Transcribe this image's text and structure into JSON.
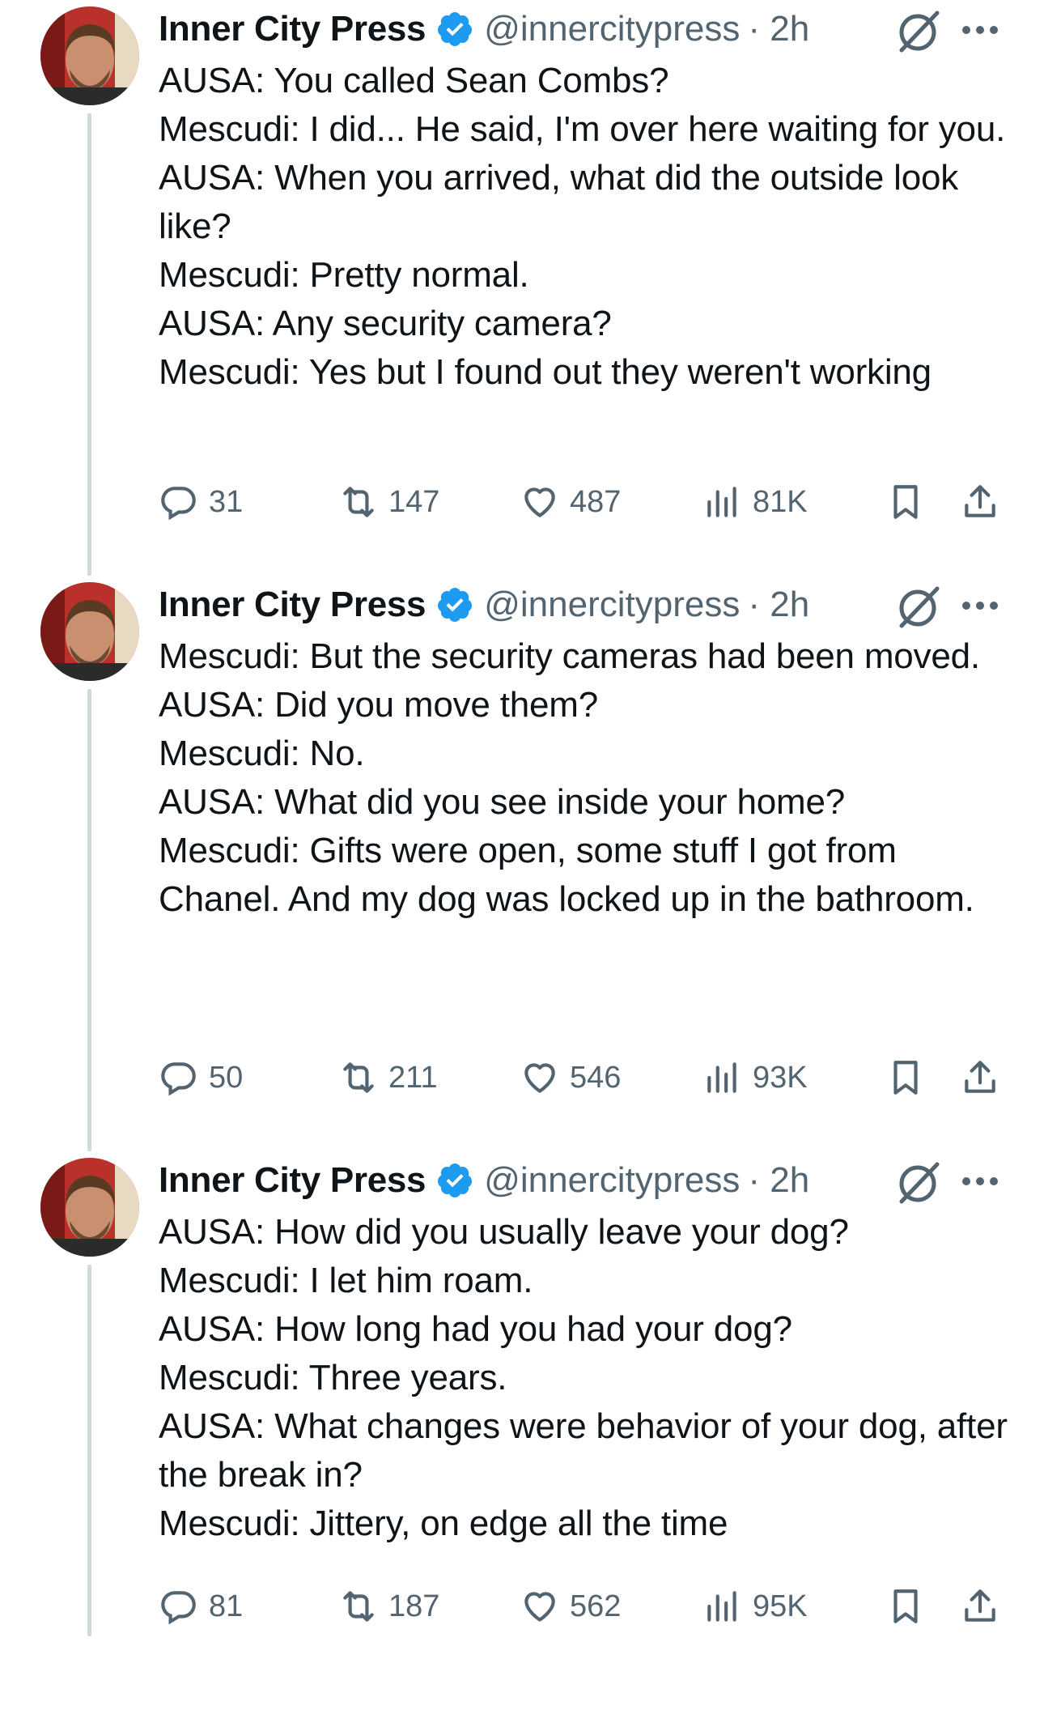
{
  "tweets": [
    {
      "author": "Inner City Press",
      "handle": "@innercitypress",
      "time": "· 2h",
      "lines": [
        "AUSA: You called Sean Combs?",
        "Mescudi: I did... He said, I'm over here waiting for you.",
        "AUSA: When you arrived, what did the outside look like?",
        "Mescudi: Pretty normal.",
        "AUSA: Any security camera?",
        "Mescudi: Yes but I found out they weren't working"
      ],
      "replies": "31",
      "reposts": "147",
      "likes": "487",
      "views": "81K"
    },
    {
      "author": "Inner City Press",
      "handle": "@innercitypress",
      "time": "· 2h",
      "lines": [
        "Mescudi: But the security cameras had been moved.",
        "AUSA: Did you move them?",
        "Mescudi: No.",
        "AUSA: What did you see inside your home?",
        "Mescudi: Gifts were open, some stuff I got from Chanel. And my dog was locked up in the bathroom."
      ],
      "replies": "50",
      "reposts": "211",
      "likes": "546",
      "views": "93K"
    },
    {
      "author": "Inner City Press",
      "handle": "@innercitypress",
      "time": "· 2h",
      "lines": [
        "AUSA: How did you usually leave your dog?",
        "Mescudi: I let him roam.",
        "AUSA: How long had you had your dog?",
        "Mescudi: Three years.",
        "AUSA: What changes were behavior of your dog, after the break in?",
        "Mescudi: Jittery, on edge all the time"
      ],
      "replies": "81",
      "reposts": "187",
      "likes": "562",
      "views": "95K"
    }
  ],
  "icons": {
    "verified": "verified-badge-icon",
    "grok": "grok-icon",
    "more": "more-icon",
    "reply": "reply-icon",
    "repost": "repost-icon",
    "like": "like-icon",
    "views": "views-icon",
    "bookmark": "bookmark-icon",
    "share": "share-icon"
  },
  "colors": {
    "text": "#0f1419",
    "secondary": "#536471",
    "verified": "#1d9bf0",
    "thread_line": "#cfd9de"
  }
}
